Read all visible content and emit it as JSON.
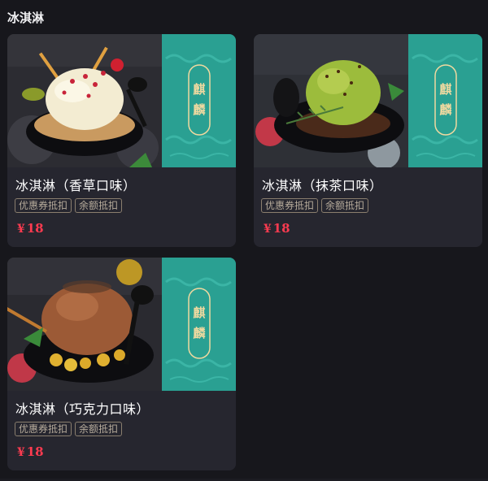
{
  "section": {
    "title": "冰淇淋"
  },
  "badge_text": "麒麟",
  "colors": {
    "background": "#17171c",
    "card": "#26262f",
    "price": "#ff3b50",
    "teal": "#2aa092"
  },
  "products": [
    {
      "name": "冰淇淋（香草口味）",
      "tags": [
        "优惠券抵扣",
        "余额抵扣"
      ],
      "currency": "¥",
      "price": "18",
      "flavor": "vanilla"
    },
    {
      "name": "冰淇淋（抹茶口味）",
      "tags": [
        "优惠券抵扣",
        "余额抵扣"
      ],
      "currency": "¥",
      "price": "18",
      "flavor": "matcha"
    },
    {
      "name": "冰淇淋（巧克力口味）",
      "tags": [
        "优惠券抵扣",
        "余额抵扣"
      ],
      "currency": "¥",
      "price": "18",
      "flavor": "chocolate"
    }
  ]
}
